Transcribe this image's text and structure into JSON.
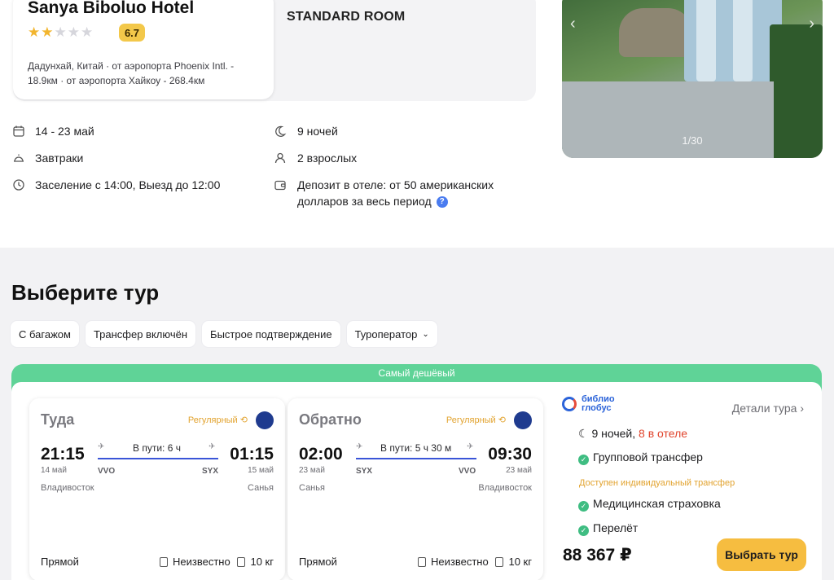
{
  "hotel": {
    "name": "Sanya Biboluo Hotel",
    "stars_filled": 2,
    "stars_total": 5,
    "rating": "6.7",
    "location": "Дадунхай, Китай · от аэропорта Phoenix Intl. - 18.9км · от аэропорта Хайкоу - 268.4км",
    "room_title": "STANDARD ROOM",
    "photo_counter": "1/30"
  },
  "details": {
    "dates": "14 - 23 май",
    "nights": "9 ночей",
    "meals": "Завтраки",
    "guests": "2 взрослых",
    "checkin": "Заселение с 14:00, Выезд до 12:00",
    "deposit": "Депозит в отеле: от 50 американских долларов за весь период"
  },
  "tours": {
    "title": "Выберите тур",
    "filters": [
      "С багажом",
      "Трансфер включён",
      "Быстрое подтверждение",
      "Туроператор"
    ]
  },
  "offer": {
    "banner": "Самый дешёвый",
    "legs": [
      {
        "title": "Туда",
        "type": "Регулярный",
        "dep_time": "21:15",
        "dep_date": "14 май",
        "dep_code": "VVO",
        "dep_city": "Владивосток",
        "duration": "В пути: 6 ч",
        "arr_time": "01:15",
        "arr_date": "15 май",
        "arr_code": "SYX",
        "arr_city": "Санья",
        "stops": "Прямой",
        "baggage": "Неизвестно",
        "hand": "10 кг"
      },
      {
        "title": "Обратно",
        "type": "Регулярный",
        "dep_time": "02:00",
        "dep_date": "23 май",
        "dep_code": "SYX",
        "dep_city": "Санья",
        "duration": "В пути: 5 ч 30 м",
        "arr_time": "09:30",
        "arr_date": "23 май",
        "arr_code": "VVO",
        "arr_city": "Владивосток",
        "stops": "Прямой",
        "baggage": "Неизвестно",
        "hand": "10 кг"
      }
    ],
    "operator_line1": "библио",
    "operator_line2": "глобус",
    "details_link": "Детали тура",
    "nights": "9 ночей,",
    "nights_hotel": "8 в отеле",
    "inclusions": [
      "Групповой трансфер",
      "Медицинская страховка",
      "Перелёт"
    ],
    "transfer_note": "Доступен индивидуальный трансфер",
    "price": "88 367 ₽",
    "choose_label": "Выбрать тур"
  },
  "colors": {
    "accent_green": "#5fd397",
    "button_yellow": "#f6bd40",
    "star": "#f2b52e",
    "warning_red": "#e0442c"
  }
}
